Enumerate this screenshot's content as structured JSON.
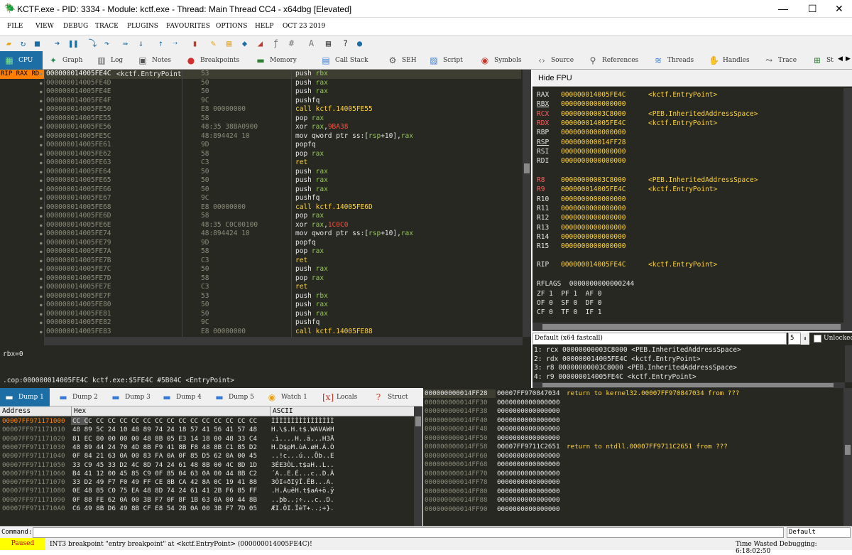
{
  "window": {
    "title": "KCTF.exe - PID: 3334 - Module: kctf.exe - Thread: Main Thread CC4 - x64dbg [Elevated]",
    "minimize": "—",
    "maximize": "☐",
    "close": "✕"
  },
  "menu": [
    "FILE",
    "VIEW",
    "DEBUG",
    "TRACE",
    "PLUGINS",
    "FAVOURITES",
    "OPTIONS",
    "HELP",
    "OCT 23 2019"
  ],
  "toolbar_icons": [
    "open-icon",
    "restart-icon",
    "close-icon",
    "run-icon",
    "pause-icon",
    "step-into-icon",
    "step-over-icon",
    "trace-into-icon",
    "trace-over-icon",
    "execute-till-return-icon",
    "run-to-user-code-icon",
    "scylla-icon",
    "comment-icon",
    "label-icon",
    "bookmark-icon",
    "function-icon",
    "fx-icon",
    "hash-icon",
    "font-icon",
    "strings-icon",
    "help-icon"
  ],
  "tabs": [
    {
      "label": "CPU",
      "icon": "cpu-icon"
    },
    {
      "label": "Graph",
      "icon": "graph-icon"
    },
    {
      "label": "Log",
      "icon": "log-icon"
    },
    {
      "label": "Notes",
      "icon": "notes-icon"
    },
    {
      "label": "Breakpoints",
      "icon": "breakpoint-icon"
    },
    {
      "label": "Memory Map",
      "icon": "memory-map-icon"
    },
    {
      "label": "Call Stack",
      "icon": "call-stack-icon"
    },
    {
      "label": "SEH",
      "icon": "seh-icon"
    },
    {
      "label": "Script",
      "icon": "script-icon"
    },
    {
      "label": "Symbols",
      "icon": "symbols-icon"
    },
    {
      "label": "Source",
      "icon": "source-icon"
    },
    {
      "label": "References",
      "icon": "references-icon"
    },
    {
      "label": "Threads",
      "icon": "threads-icon"
    },
    {
      "label": "Handles",
      "icon": "handles-icon"
    },
    {
      "label": "Trace",
      "icon": "trace-icon"
    },
    {
      "label": "St",
      "icon": "struct-tab-icon"
    }
  ],
  "disasm": {
    "rip_label": "RIP RAX RD",
    "first_label": "<kctf.EntryPoint",
    "rows": [
      [
        "000000014005FE4C",
        "53",
        "push rbx"
      ],
      [
        "000000014005FE4D",
        "50",
        "push rax"
      ],
      [
        "000000014005FE4E",
        "50",
        "push rax"
      ],
      [
        "000000014005FE4F",
        "9C",
        "pushfq"
      ],
      [
        "000000014005FE50",
        "E8 00000000",
        "call kctf.14005FE55"
      ],
      [
        "000000014005FE55",
        "58",
        "pop rax"
      ],
      [
        "000000014005FE56",
        "48:35 38BA0900",
        "xor rax,9BA38"
      ],
      [
        "000000014005FE5C",
        "48:894424 10",
        "mov qword ptr ss:[rsp+10],rax"
      ],
      [
        "000000014005FE61",
        "9D",
        "popfq"
      ],
      [
        "000000014005FE62",
        "58",
        "pop rax"
      ],
      [
        "000000014005FE63",
        "C3",
        "ret"
      ],
      [
        "000000014005FE64",
        "50",
        "push rax"
      ],
      [
        "000000014005FE65",
        "50",
        "push rax"
      ],
      [
        "000000014005FE66",
        "50",
        "push rax"
      ],
      [
        "000000014005FE67",
        "9C",
        "pushfq"
      ],
      [
        "000000014005FE68",
        "E8 00000000",
        "call kctf.14005FE6D"
      ],
      [
        "000000014005FE6D",
        "58",
        "pop rax"
      ],
      [
        "000000014005FE6E",
        "48:35 C0C00100",
        "xor rax,1C0C0"
      ],
      [
        "000000014005FE74",
        "48:894424 10",
        "mov qword ptr ss:[rsp+10],rax"
      ],
      [
        "000000014005FE79",
        "9D",
        "popfq"
      ],
      [
        "000000014005FE7A",
        "58",
        "pop rax"
      ],
      [
        "000000014005FE7B",
        "C3",
        "ret"
      ],
      [
        "000000014005FE7C",
        "50",
        "push rax"
      ],
      [
        "000000014005FE7D",
        "58",
        "pop rax"
      ],
      [
        "000000014005FE7E",
        "C3",
        "ret"
      ],
      [
        "000000014005FE7F",
        "53",
        "push rbx"
      ],
      [
        "000000014005FE80",
        "50",
        "push rax"
      ],
      [
        "000000014005FE81",
        "50",
        "push rax"
      ],
      [
        "000000014005FE82",
        "9C",
        "pushfq"
      ],
      [
        "000000014005FE83",
        "E8 00000000",
        "call kctf.14005FE88"
      ]
    ]
  },
  "registers": {
    "hide_fpu": "Hide FPU",
    "general": [
      [
        "RAX",
        "000000014005FE4C",
        "<kctf.EntryPoint>"
      ],
      [
        "RBX",
        "0000000000000000",
        ""
      ],
      [
        "RCX",
        "00000000003C8000",
        "<PEB.InheritedAddressSpace>"
      ],
      [
        "RDX",
        "000000014005FE4C",
        "<kctf.EntryPoint>"
      ],
      [
        "RBP",
        "0000000000000000",
        ""
      ],
      [
        "RSP",
        "000000000014FF28",
        ""
      ],
      [
        "RSI",
        "0000000000000000",
        ""
      ],
      [
        "RDI",
        "0000000000000000",
        ""
      ]
    ],
    "extended": [
      [
        "R8",
        "00000000003C8000",
        "<PEB.InheritedAddressSpace>"
      ],
      [
        "R9",
        "000000014005FE4C",
        "<kctf.EntryPoint>"
      ],
      [
        "R10",
        "0000000000000000",
        ""
      ],
      [
        "R11",
        "0000000000000000",
        ""
      ],
      [
        "R12",
        "0000000000000000",
        ""
      ],
      [
        "R13",
        "0000000000000000",
        ""
      ],
      [
        "R14",
        "0000000000000000",
        ""
      ],
      [
        "R15",
        "0000000000000000",
        ""
      ]
    ],
    "rip": [
      "RIP",
      "000000014005FE4C",
      "<kctf.EntryPoint>"
    ],
    "rflags": "RFLAGS  0000000000000244",
    "flags": [
      "ZF 1  PF 1  AF 0",
      "OF 0  SF 0  DF 0",
      "CF 0  TF 0  IF 1"
    ]
  },
  "callconv": {
    "selected": "Default (x64 fastcall)",
    "count": "5",
    "unlocked": "Unlocked"
  },
  "args": [
    "1: rcx 00000000003C8000 <PEB.InheritedAddressSpace>",
    "2: rdx 000000014005FE4C <kctf.EntryPoint>",
    "3: r8 00000000003C8000 <PEB.InheritedAddressSpace>",
    "4: r9 000000014005FE4C <kctf.EntryPoint>"
  ],
  "info": {
    "line1": "rbx=0",
    "line2": ".cop:000000014005FE4C kctf.exe:$5FE4C #5B04C <EntryPoint>"
  },
  "dump_tabs": [
    {
      "label": "Dump 1",
      "icon": "dump-icon"
    },
    {
      "label": "Dump 2",
      "icon": "dump-icon"
    },
    {
      "label": "Dump 3",
      "icon": "dump-icon"
    },
    {
      "label": "Dump 4",
      "icon": "dump-icon"
    },
    {
      "label": "Dump 5",
      "icon": "dump-icon"
    },
    {
      "label": "Watch 1",
      "icon": "watch-icon"
    },
    {
      "label": "Locals",
      "icon": "locals-icon"
    },
    {
      "label": "Struct",
      "icon": "struct-icon"
    }
  ],
  "dump": {
    "headers": [
      "Address",
      "Hex",
      "ASCII"
    ],
    "rows": [
      [
        "00007FF971171000",
        "CC CC CC CC CC CC CC CC CC CC CC CC CC CC CC CC",
        "ÌÌÌÌÌÌÌÌÌÌÌÌÌÌÌÌ"
      ],
      [
        "00007FF971171010",
        "48 89 5C 24 10 48 89 74 24 18 57 41 56 41 57 48",
        "H.\\$.H.t$.WAVAWH"
      ],
      [
        "00007FF971171020",
        "81 EC 80 00 00 00 48 8B 05 E3 14 18 00 48 33 C4",
        ".ì....H..ã...H3Ä"
      ],
      [
        "00007FF971171030",
        "48 89 44 24 70 4D 8B F9 41 8B F8 48 8B C1 85 D2",
        "H.D$pM.ùA.øH.Á.Ò"
      ],
      [
        "00007FF971171040",
        "0F 84 21 63 0A 00 83 FA 0A 0F 85 D5 62 0A 00 45",
        "..!c...ú...Õb..E"
      ],
      [
        "00007FF971171050",
        "33 C9 45 33 D2 4C 8D 74 24 61 48 8B 00 4C 8D 1D",
        "3ÉE3ÒL.t$aH..L.."
      ],
      [
        "00007FF971171060",
        "B4 41 12 00 45 85 C9 0F 85 04 63 0A 00 44 8B C2",
        "´A..E.É...c..D.Â"
      ],
      [
        "00007FF971171070",
        "33 D2 49 F7 F0 49 FF CE 8B CA 42 8A 0C 19 41 88",
        "3ÒI÷ðIÿÎ.ÊB...A."
      ],
      [
        "00007FF971171080",
        "0E 48 85 C0 75 EA 48 8D 74 24 61 41 2B F6 85 FF",
        ".H.ÀuêH.t$aA+ö.ÿ"
      ],
      [
        "00007FF971171090",
        "0F 88 FE 62 0A 00 3B F7 0F 8F 1B 63 0A 00 44 8B",
        "..þb..;÷...c..D."
      ],
      [
        "00007FF9711710A0",
        "C6 49 8B D6 49 8B CF E8 54 2B 0A 00 3B F7 7D 05",
        "ÆI.ÖI.ÏèT+..;÷}."
      ]
    ]
  },
  "stack": {
    "rows": [
      [
        "000000000014FF28",
        "00007FF970847034",
        "return to kernel32.00007FF970847034 from ???"
      ],
      [
        "000000000014FF30",
        "0000000000000000",
        ""
      ],
      [
        "000000000014FF38",
        "0000000000000000",
        ""
      ],
      [
        "000000000014FF40",
        "0000000000000000",
        ""
      ],
      [
        "000000000014FF48",
        "0000000000000000",
        ""
      ],
      [
        "000000000014FF50",
        "0000000000000000",
        ""
      ],
      [
        "000000000014FF58",
        "00007FF9711C2651",
        "return to ntdll.00007FF9711C2651 from ???"
      ],
      [
        "000000000014FF60",
        "0000000000000000",
        ""
      ],
      [
        "000000000014FF68",
        "0000000000000000",
        ""
      ],
      [
        "000000000014FF70",
        "0000000000000000",
        ""
      ],
      [
        "000000000014FF78",
        "0000000000000000",
        ""
      ],
      [
        "000000000014FF80",
        "0000000000000000",
        ""
      ],
      [
        "000000000014FF88",
        "0000000000000000",
        ""
      ],
      [
        "000000000014FF90",
        "0000000000000000",
        ""
      ]
    ]
  },
  "command": {
    "label": "Command:",
    "value": "",
    "mode": "Default"
  },
  "status": {
    "state": "Paused",
    "message": "INT3 breakpoint \"entry breakpoint\" at <kctf.EntryPoint> (000000014005FE4C)!",
    "time": "Time Wasted Debugging: 6:18:02:50"
  },
  "colors": {
    "accent": "#1c6ea4",
    "panel_bg": "#272822",
    "paused": "#ffff00",
    "rip": "#ff8000"
  }
}
